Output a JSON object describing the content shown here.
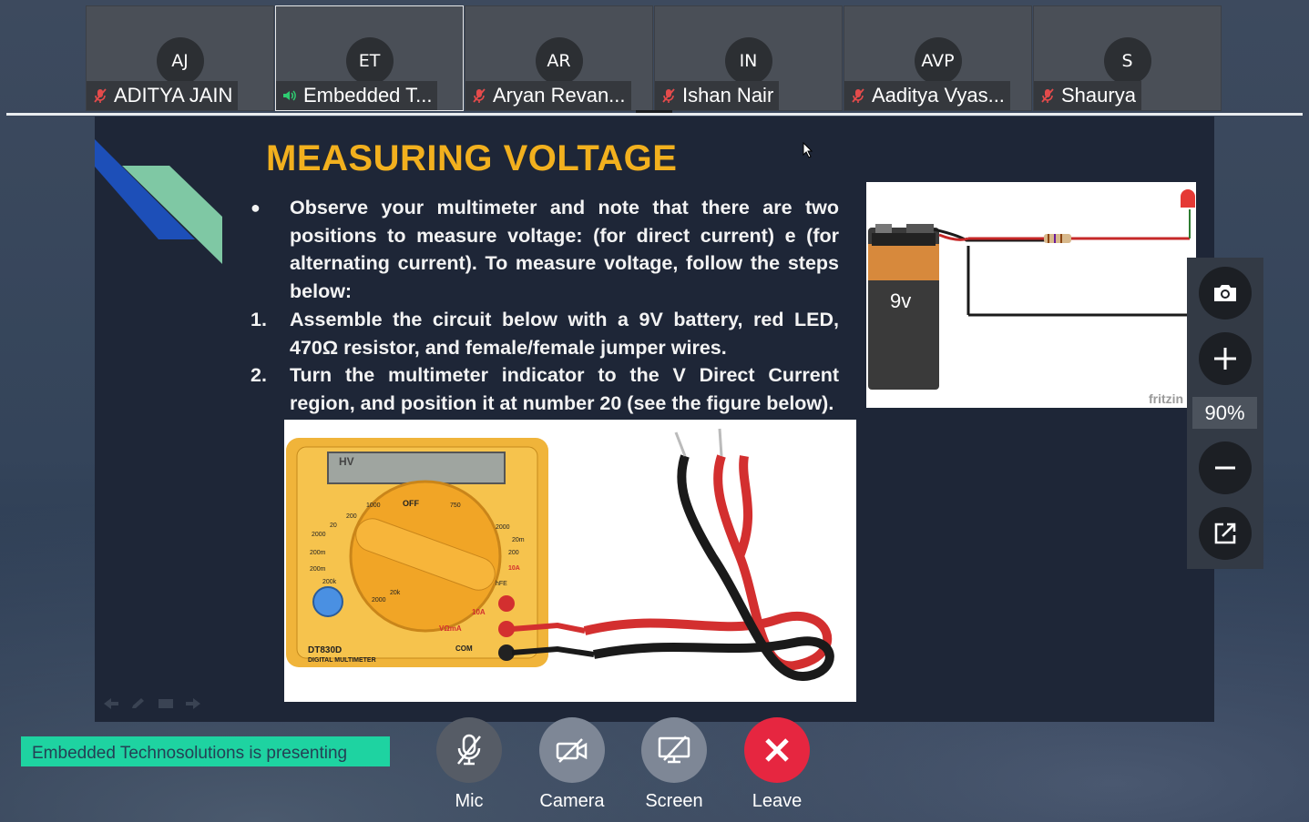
{
  "participants": [
    {
      "initials": "AJ",
      "name": "ADITYA JAIN",
      "muted": true
    },
    {
      "initials": "ET",
      "name": "Embedded T...",
      "muted": false,
      "speaking": true
    },
    {
      "initials": "AR",
      "name": "Aryan Revan...",
      "muted": true
    },
    {
      "initials": "IN",
      "name": "Ishan Nair",
      "muted": true
    },
    {
      "initials": "AVP",
      "name": "Aaditya Vyas...",
      "muted": true
    },
    {
      "initials": "S",
      "name": "Shaurya",
      "muted": true
    }
  ],
  "slide": {
    "title": "MEASURING VOLTAGE",
    "bullet_marker": "●",
    "bullet": "Observe your multimeter and note that there are two positions to measure voltage:   (for direct current) e   (for alternating current). To measure voltage, follow the steps below:",
    "steps": [
      {
        "marker": "1.",
        "text": "Assemble the circuit below with a 9V battery, red LED, 470Ω resistor, and female/female jumper wires."
      },
      {
        "marker": "2.",
        "text": "Turn the multimeter indicator to the V Direct Current region, and position it at number 20 (see the figure below)."
      }
    ],
    "circuit_battery_label": "9v",
    "circuit_watermark": "fritzin",
    "meter": {
      "screen_text": "HV",
      "model": "DT830D",
      "subtitle": "DIGITAL MULTIMETER",
      "dial_labels": [
        "OFF",
        "1000",
        "750",
        "200",
        "2000",
        "20",
        "200m",
        "2000",
        "200",
        "20m",
        "10A",
        "hFE",
        "200m",
        "2000",
        "200k",
        "20k"
      ],
      "port_labels": [
        "10A",
        "VΩmA",
        "COM"
      ]
    }
  },
  "zoom": {
    "level": "90%"
  },
  "presenting_text": "Embedded Technosolutions  is presenting",
  "controls": [
    {
      "id": "mic",
      "label": "Mic"
    },
    {
      "id": "camera",
      "label": "Camera"
    },
    {
      "id": "screen",
      "label": "Screen"
    },
    {
      "id": "leave",
      "label": "Leave"
    }
  ],
  "colors": {
    "leave": "#e62640",
    "control": "#7e8796",
    "presenting_bg": "#1ed3a1",
    "title": "#f2b01e",
    "mic_muted": "#e44b4b",
    "mic_active": "#2ecc71"
  }
}
